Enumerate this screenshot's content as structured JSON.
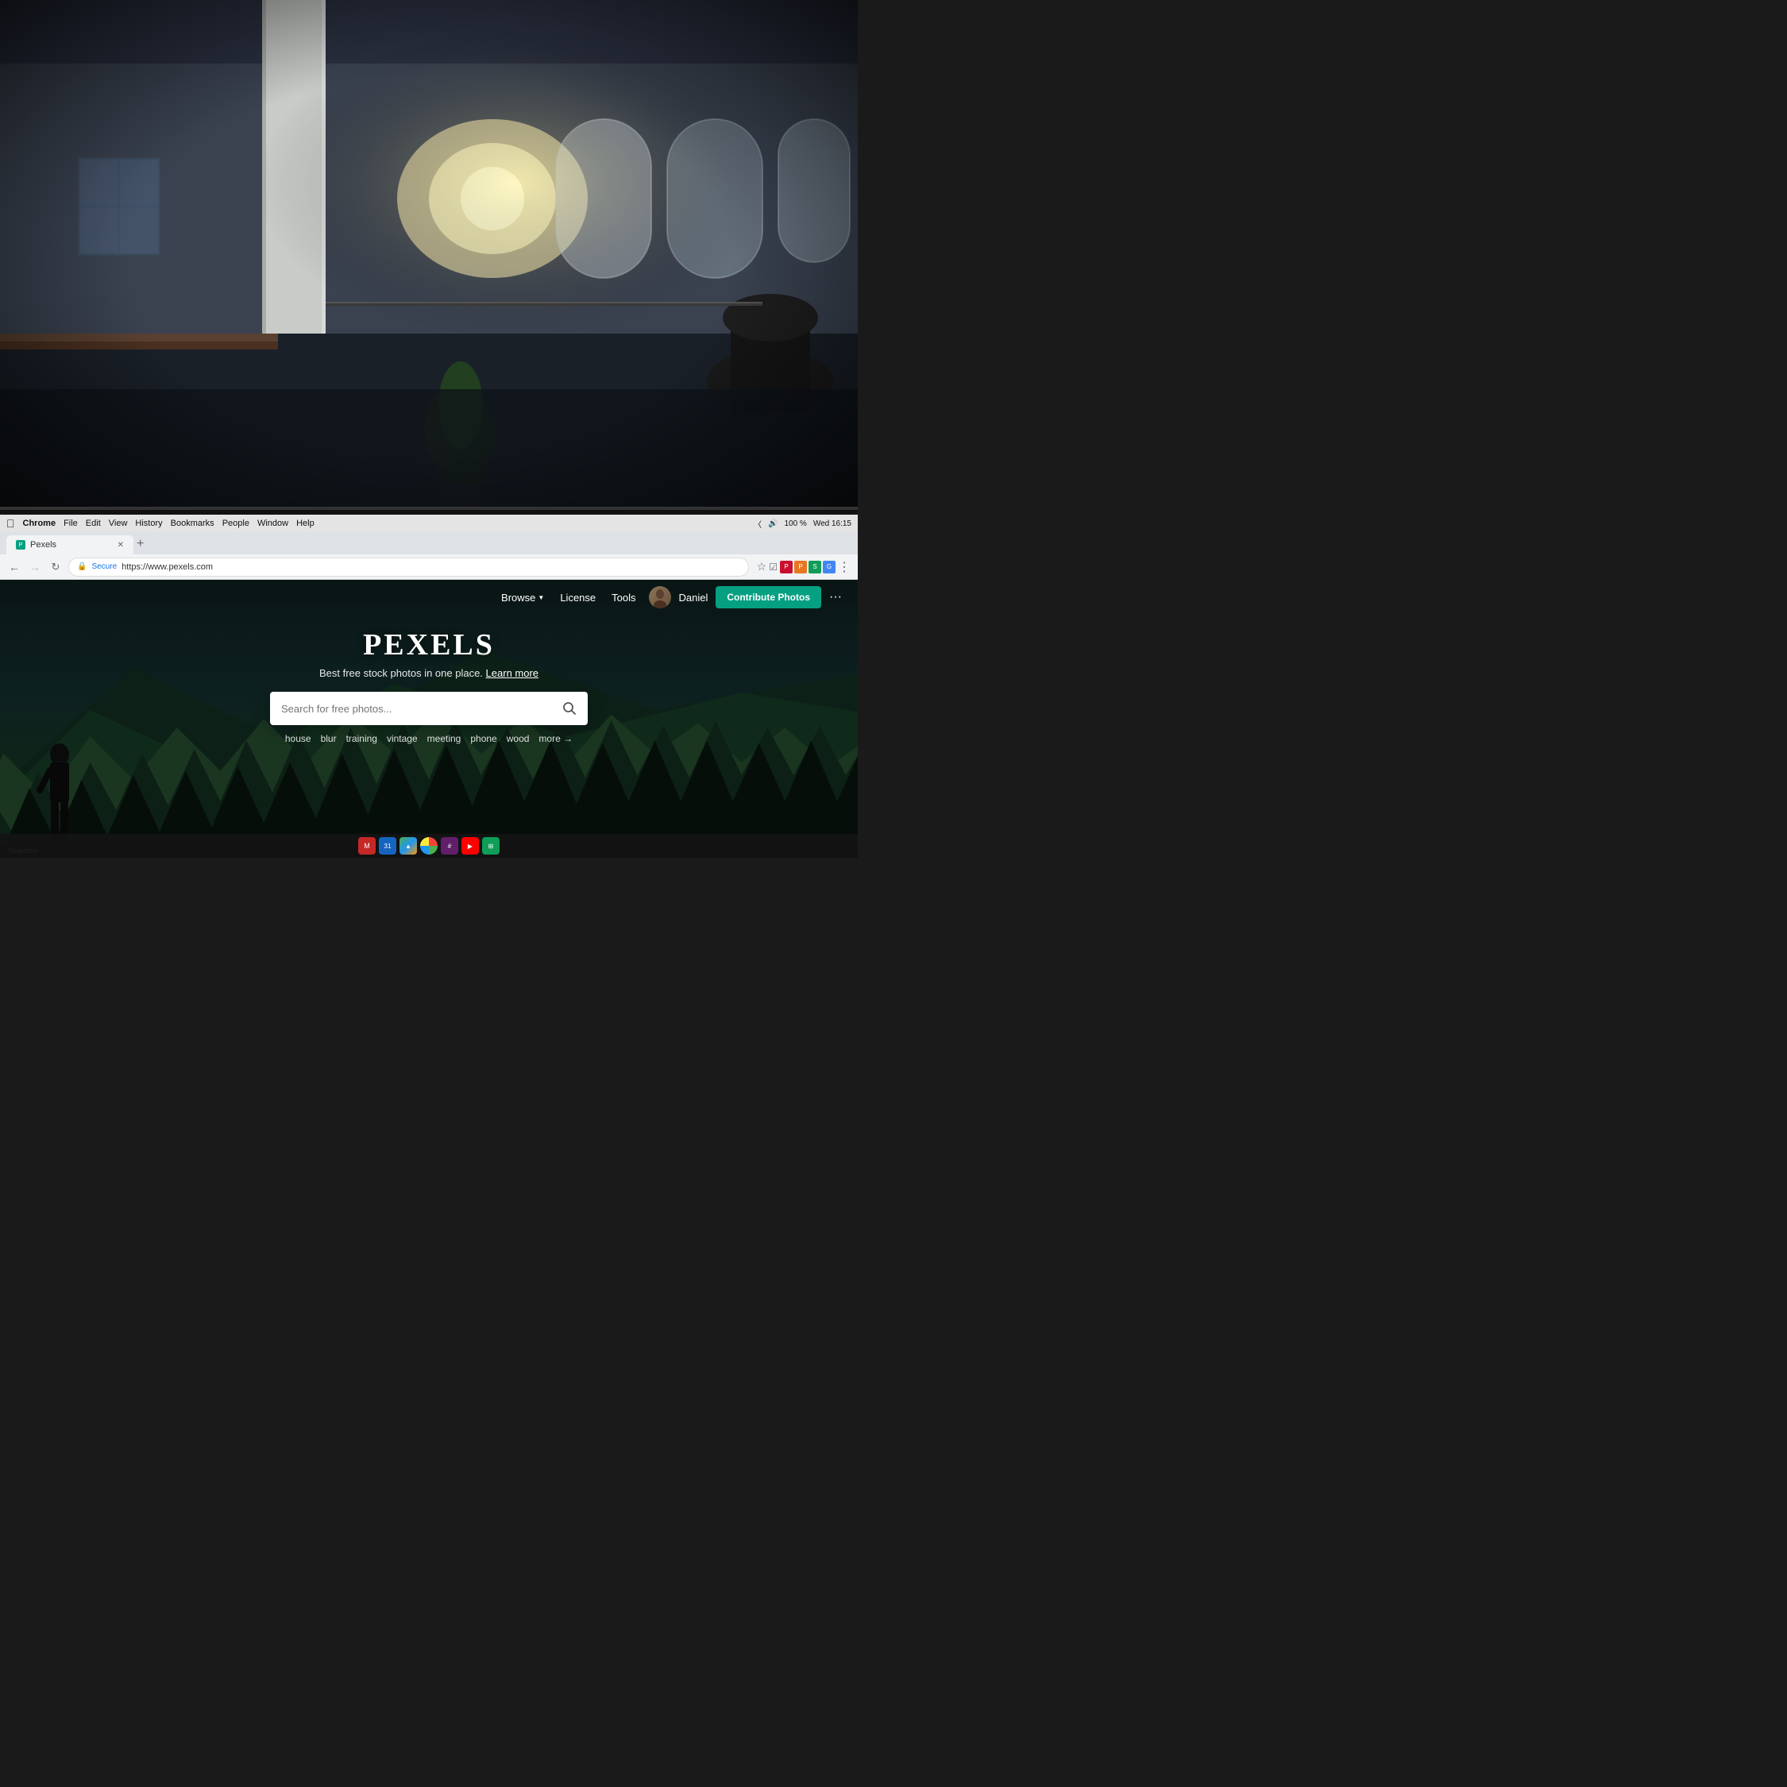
{
  "background": {
    "description": "Office workspace photo with blurred background showing open office, columns, plants, windows with light"
  },
  "macos_menubar": {
    "app_name": "Chrome",
    "menu_items": [
      "File",
      "Edit",
      "View",
      "History",
      "Bookmarks",
      "People",
      "Window",
      "Help"
    ],
    "time": "Wed 16:15",
    "battery": "100 %"
  },
  "chrome": {
    "tab_title": "Pexels",
    "address": "https://www.pexels.com",
    "secure_label": "Secure",
    "back_label": "←",
    "reload_label": "↻"
  },
  "pexels": {
    "nav": {
      "browse_label": "Browse",
      "license_label": "License",
      "tools_label": "Tools",
      "user_label": "Daniel",
      "contribute_label": "Contribute Photos",
      "more_label": "···"
    },
    "hero": {
      "logo": "PEXELS",
      "tagline": "Best free stock photos in one place.",
      "learn_more": "Learn more",
      "search_placeholder": "Search for free photos...",
      "suggestions": [
        "house",
        "blur",
        "training",
        "vintage",
        "meeting",
        "phone",
        "wood"
      ],
      "more_label": "more →"
    }
  },
  "bottom_bar": {
    "searches_label": "Searches"
  }
}
